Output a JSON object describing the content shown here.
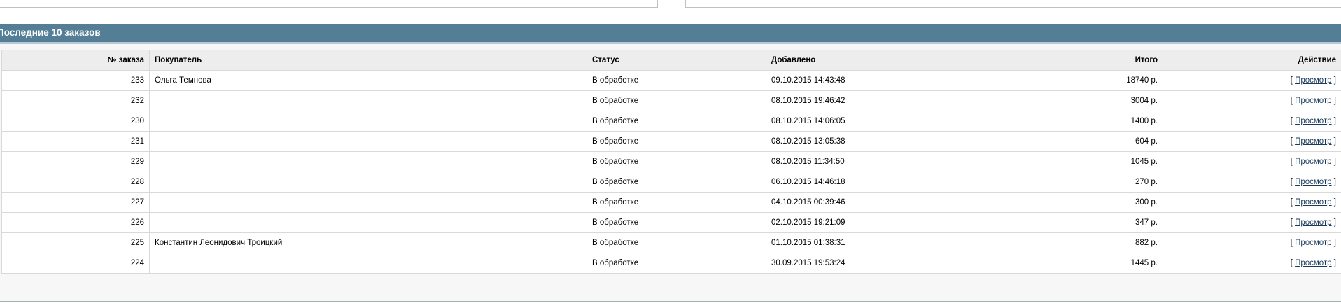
{
  "panel": {
    "title": "Последние 10 заказов"
  },
  "table": {
    "headers": {
      "order_no": "№ заказа",
      "customer": "Покупатель",
      "status": "Статус",
      "added": "Добавлено",
      "total": "Итого",
      "action": "Действие"
    },
    "view_label": "Просмотр",
    "bracket_open": "[",
    "bracket_close": "]",
    "rows": [
      {
        "order_no": "233",
        "customer": "Ольга Темнова",
        "status": "В обработке",
        "added": "09.10.2015 14:43:48",
        "total": "18740 р."
      },
      {
        "order_no": "232",
        "customer": "",
        "status": "В обработке",
        "added": "08.10.2015 19:46:42",
        "total": "3004 р."
      },
      {
        "order_no": "230",
        "customer": "",
        "status": "В обработке",
        "added": "08.10.2015 14:06:05",
        "total": "1400 р."
      },
      {
        "order_no": "231",
        "customer": "",
        "status": "В обработке",
        "added": "08.10.2015 13:05:38",
        "total": "604 р."
      },
      {
        "order_no": "229",
        "customer": "",
        "status": "В обработке",
        "added": "08.10.2015 11:34:50",
        "total": "1045 р."
      },
      {
        "order_no": "228",
        "customer": "",
        "status": "В обработке",
        "added": "06.10.2015 14:46:18",
        "total": "270 р."
      },
      {
        "order_no": "227",
        "customer": "",
        "status": "В обработке",
        "added": "04.10.2015 00:39:46",
        "total": "300 р."
      },
      {
        "order_no": "226",
        "customer": "",
        "status": "В обработке",
        "added": "02.10.2015 19:21:09",
        "total": "347 р."
      },
      {
        "order_no": "225",
        "customer": "Константин Леонидович Троицкий",
        "status": "В обработке",
        "added": "01.10.2015 01:38:31",
        "total": "882 р."
      },
      {
        "order_no": "224",
        "customer": "",
        "status": "В обработке",
        "added": "30.09.2015 19:53:24",
        "total": "1445 р."
      }
    ]
  }
}
